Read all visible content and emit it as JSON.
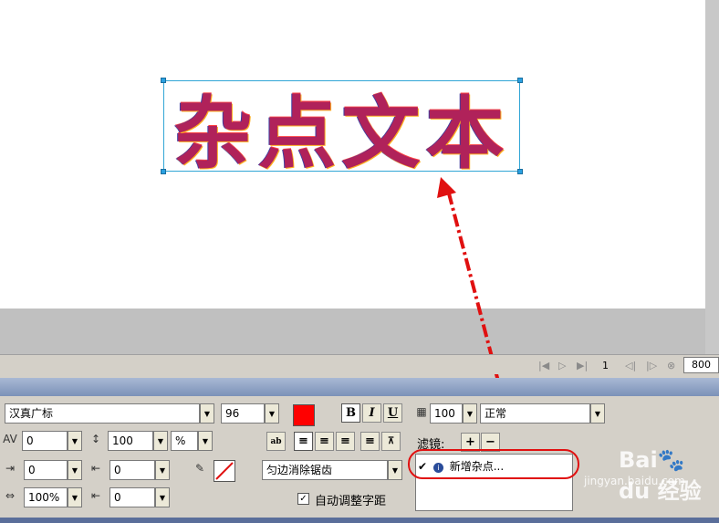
{
  "canvas": {
    "text": "杂点文本"
  },
  "frame_bar": {
    "frame": "1",
    "zoom": "800"
  },
  "props": {
    "font": "汉真广标",
    "size": "96",
    "bold": "B",
    "italic": "I",
    "underline": "U",
    "kerning": "0",
    "leading": "100",
    "leading_unit": "%",
    "indent": "0",
    "space_before": "0",
    "scale": "100%",
    "space_after": "0",
    "antialias": "匀边消除锯齿",
    "auto_kern_label": "自动调整字距",
    "opacity": "100",
    "blend_mode": "正常",
    "filters_label": "滤镜:",
    "add_filter": "+",
    "remove_filter": "−",
    "filter_item": "新增杂点..."
  },
  "colors": {
    "fill": "#ff0000",
    "annotation": "#e01010"
  },
  "watermark": {
    "main": "Bai🐾du 经验",
    "sub": "jingyan.baidu.com"
  }
}
